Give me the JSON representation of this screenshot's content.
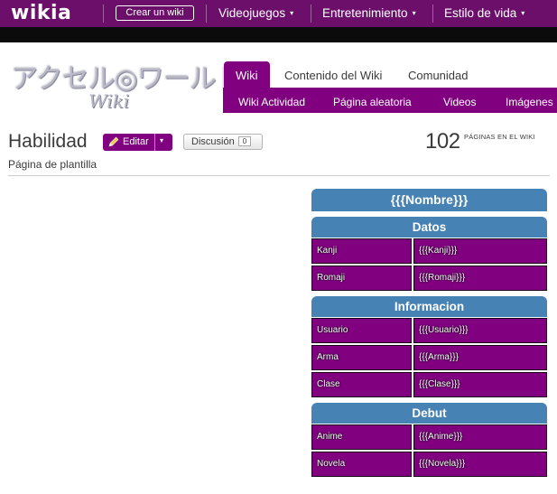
{
  "global_nav": {
    "logo": "wikia",
    "create_button": "Crear un wiki",
    "links": [
      {
        "label": "Videojuegos"
      },
      {
        "label": "Entretenimiento"
      },
      {
        "label": "Estilo de vida"
      }
    ],
    "caret": "▾"
  },
  "wiki": {
    "wordmark_jp": "アクセル◎ワールド",
    "wordmark_wiki": "Wiki",
    "tabs": [
      {
        "label": "Wiki",
        "active": true
      },
      {
        "label": "Contenido del Wiki",
        "active": false
      },
      {
        "label": "Comunidad",
        "active": false
      }
    ],
    "subnav": [
      {
        "label": "Wiki Actividad"
      },
      {
        "label": "Página aleatoria"
      },
      {
        "label": "Videos"
      },
      {
        "label": "Imágenes"
      }
    ]
  },
  "page": {
    "title": "Habilidad",
    "edit_label": "Editar",
    "discussion_label": "Discusión",
    "discussion_count": "0",
    "page_count": "102",
    "page_count_label": "PÁGINAS EN EL WIKI",
    "subtitle": "Página de plantilla"
  },
  "infobox": {
    "title": "{{{Nombre}}}",
    "sections": [
      {
        "heading": "Datos",
        "rows": [
          {
            "key": "Kanji",
            "value": "{{{Kanji}}}"
          },
          {
            "key": "Romaji",
            "value": "{{{Romaji}}}"
          }
        ]
      },
      {
        "heading": "Informacion",
        "rows": [
          {
            "key": "Usuario",
            "value": "{{{Usuario}}}"
          },
          {
            "key": "Arma",
            "value": "{{{Arma}}}"
          },
          {
            "key": "Clase",
            "value": "{{{Clase}}}"
          }
        ]
      },
      {
        "heading": "Debut",
        "rows": [
          {
            "key": "Anime",
            "value": "{{{Anime}}}"
          },
          {
            "key": "Novela",
            "value": "{{{Novela}}}"
          }
        ]
      }
    ]
  },
  "colors": {
    "nav_purple": "#6b0f6b",
    "accent_purple": "#800080",
    "infobox_blue": "#4682b4"
  }
}
